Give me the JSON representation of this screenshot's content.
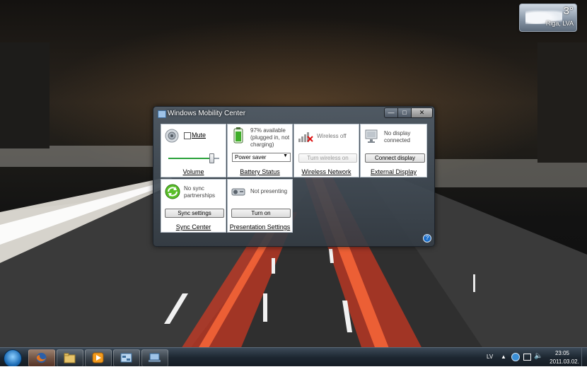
{
  "weather": {
    "temperature": "3°",
    "city": "Riga, LVA"
  },
  "window": {
    "title": "Windows Mobility Center",
    "help_label": "?",
    "caption": {
      "minimize": "—",
      "maximize": "□",
      "close": "✕"
    },
    "tiles": {
      "volume": {
        "mute_label": "Mute",
        "mute_checked": false,
        "level": 0.85,
        "label": "Volume"
      },
      "battery": {
        "status": "97% available (plugged in, not charging)",
        "plan": "Power saver",
        "label": "Battery Status"
      },
      "wireless": {
        "status": "Wireless off",
        "button": "Turn wireless on",
        "button_enabled": false,
        "label": "Wireless Network"
      },
      "display": {
        "status": "No display connected",
        "button": "Connect display",
        "label": "External Display"
      },
      "sync": {
        "status": "No sync partnerships",
        "button": "Sync settings",
        "label": "Sync Center"
      },
      "presentation": {
        "status": "Not presenting",
        "button": "Turn on",
        "label": "Presentation Settings"
      }
    }
  },
  "taskbar": {
    "apps": [
      {
        "name": "firefox",
        "active": true
      },
      {
        "name": "windows-explorer",
        "active": false
      },
      {
        "name": "media-player",
        "active": false
      },
      {
        "name": "control-panel",
        "active": false
      },
      {
        "name": "mobility-center",
        "active": false
      }
    ],
    "language": "LV",
    "tray_arrow": "▲",
    "clock_time": "23:05",
    "clock_date": "2011.03.02."
  },
  "colors": {
    "accent_blue": "#1d6fc9",
    "battery_green": "#3fae2a",
    "sync_green": "#5bbf2a"
  }
}
